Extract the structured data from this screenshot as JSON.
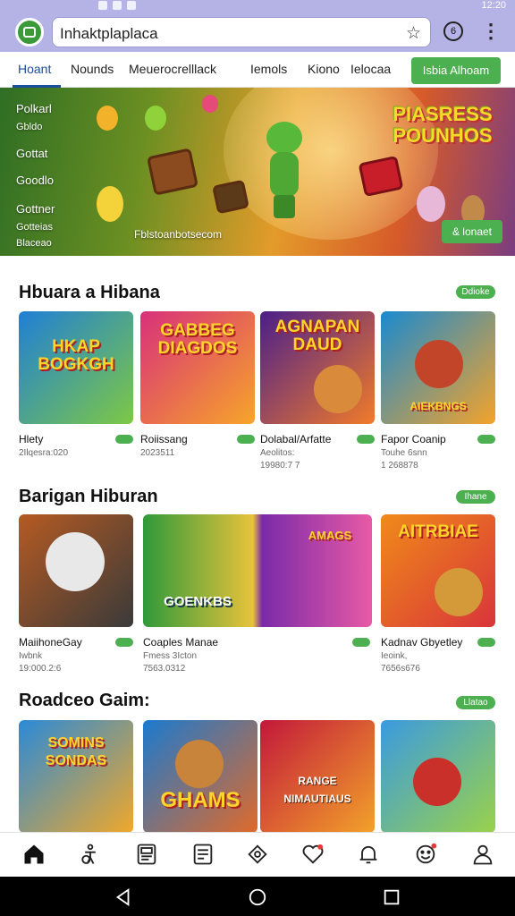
{
  "status_bar": {
    "time": "12:20"
  },
  "browser": {
    "url": "Inhaktplaplaca",
    "tab_count": "6"
  },
  "nav": {
    "tabs": [
      "Hoant",
      "Nounds",
      "Meuerocrelllack",
      "Iemols",
      "Kiono",
      "Ielocaa"
    ],
    "cta_label": "Isbia Alhoam"
  },
  "hero": {
    "side_lines": [
      "Polkarl",
      "Gbldo",
      "Gottat",
      "Goodlo",
      "Gottner",
      "Gotteias",
      "Blaceao"
    ],
    "title": "PIASRESS POUNHOS",
    "caption": "Fblstoanbotsecom",
    "button_label": "& lonaet"
  },
  "sections": [
    {
      "title": "Hbuara a Hibana",
      "see_all": "Ddioke",
      "cards": [
        {
          "art": "HKAP BOGKGH",
          "name": "Hlety",
          "meta1": "2Ilqesra:020",
          "meta2": "",
          "colors": [
            "#1f7fd6",
            "#7ec845"
          ]
        },
        {
          "art": "GABBEG DIAGDOS",
          "name": "Roiissang",
          "meta1": "2023511",
          "meta2": "",
          "colors": [
            "#d8307a",
            "#f7a52a"
          ]
        },
        {
          "art": "AGNAPAN DAUD",
          "name": "Dolabal/Arfatte",
          "meta1": "Aeolitos:",
          "meta2": "19980:7 7",
          "colors": [
            "#4a1f8a",
            "#f27b2a"
          ]
        },
        {
          "art": "AIEKBNGS",
          "name": "Fapor Coanip",
          "meta1": "Touhe 6snn",
          "meta2": "1 268878",
          "colors": [
            "#1a8ad0",
            "#f4a32a"
          ]
        }
      ]
    },
    {
      "title": "Barigan Hiburan",
      "see_all": "Ihane",
      "cards": [
        {
          "art": "",
          "name": "MaiihoneGay",
          "meta1": "Iwbnk",
          "meta2": "19:000.2:6",
          "colors": [
            "#b55a22",
            "#3a3a3a"
          ]
        },
        {
          "art": "GOENKBS",
          "name": "Coaples Manae",
          "meta1": "Fmess 3Icton",
          "meta2": "7563.0312",
          "colors": [
            "#2f9a3a",
            "#e8c23a"
          ]
        },
        {
          "art": "AMAGS",
          "name": "",
          "meta1": "",
          "meta2": "",
          "colors": [
            "#7a2aa8",
            "#e85aa6"
          ]
        },
        {
          "art": "AITRBIAE",
          "name": "Kadnav Gbyetley",
          "meta1": "Ieoink,",
          "meta2": "7656s676",
          "colors": [
            "#f08a1a",
            "#d8353a"
          ]
        }
      ]
    },
    {
      "title": "Roadceo Gaim:",
      "see_all": "Llatao",
      "cards": [
        {
          "art": "SOMINS SONDAS",
          "name": "",
          "meta1": "",
          "meta2": "",
          "colors": [
            "#2a8ad8",
            "#f0a82a"
          ]
        },
        {
          "art": "GHAMS",
          "name": "",
          "meta1": "",
          "meta2": "",
          "colors": [
            "#1a7ad0",
            "#e06a2a"
          ]
        },
        {
          "art": "RANGE NIMAUTIAUS",
          "name": "",
          "meta1": "",
          "meta2": "",
          "colors": [
            "#c2183a",
            "#f2a22a"
          ]
        },
        {
          "art": "",
          "name": "",
          "meta1": "",
          "meta2": "",
          "colors": [
            "#3a9ae0",
            "#9ad24a"
          ]
        }
      ]
    }
  ],
  "bottom_nav": [
    "home-icon",
    "accessibility-icon",
    "news-icon",
    "list-icon",
    "shop-icon",
    "heart-icon",
    "bell-icon",
    "smile-icon",
    "profile-icon"
  ]
}
